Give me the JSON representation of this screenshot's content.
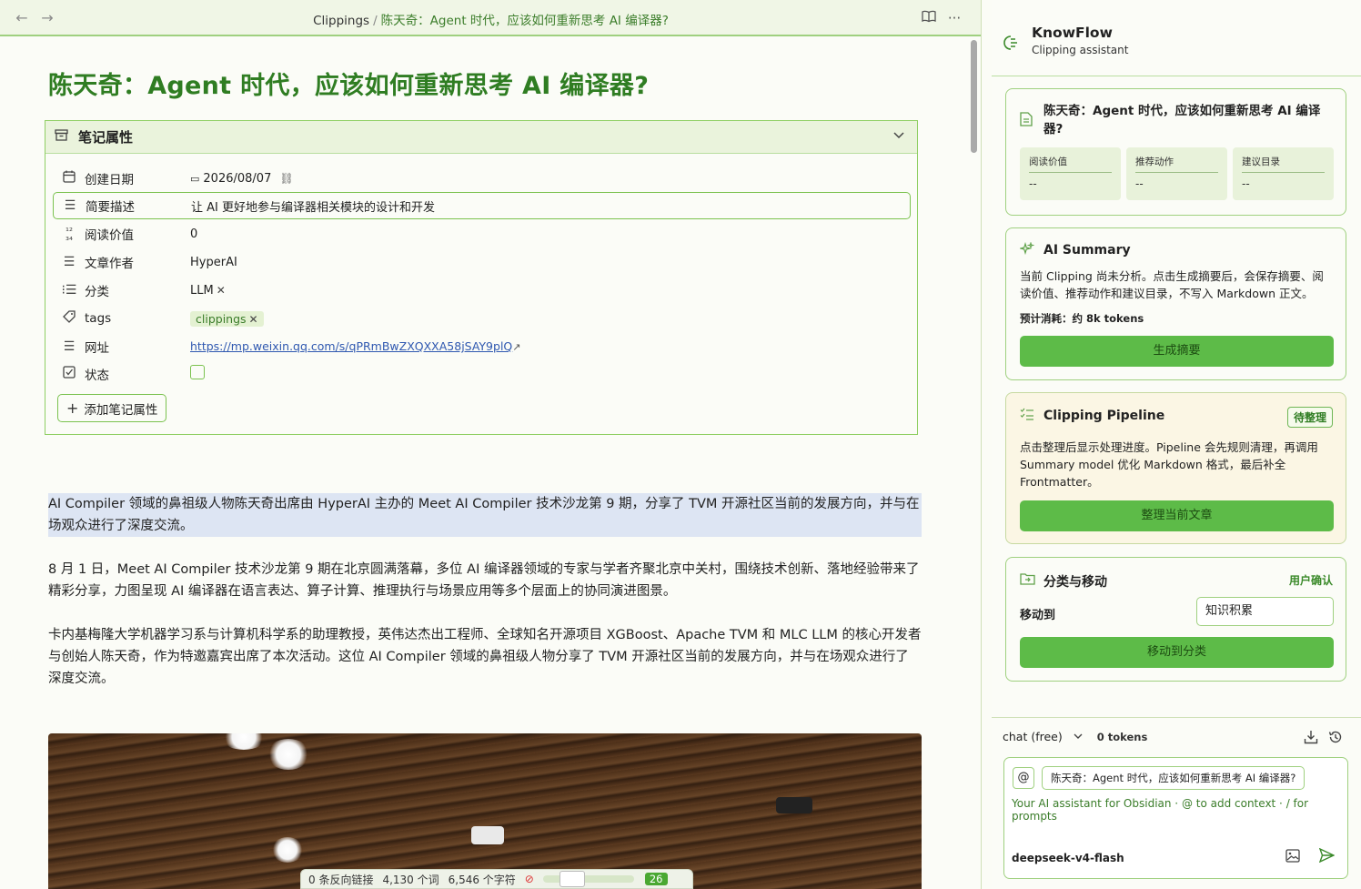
{
  "topbar": {
    "back": "←",
    "forward": "→",
    "crumb_root": "Clippings",
    "crumb_sep": "/",
    "crumb_current": "陈天奇：Agent 时代，应该如何重新思考 AI 编译器?",
    "book_icon": "📖",
    "more_icon": "···"
  },
  "doc": {
    "title": "陈天奇：Agent 时代，应该如何重新思考 AI 编译器?"
  },
  "properties": {
    "header": "笔记属性",
    "rows": [
      {
        "name": "创建日期",
        "icon": "calendar-icon",
        "value": "2026/08/07"
      },
      {
        "name": "简要描述",
        "icon": "text-icon",
        "value": "让 AI 更好地参与编译器相关模块的设计和开发"
      },
      {
        "name": "阅读价值",
        "icon": "number-icon",
        "value": "0"
      },
      {
        "name": "文章作者",
        "icon": "text-icon",
        "value": "HyperAI"
      },
      {
        "name": "分类",
        "icon": "list-icon",
        "value": "LLM"
      },
      {
        "name": "tags",
        "icon": "tag-icon",
        "value": "clippings"
      },
      {
        "name": "网址",
        "icon": "text-icon",
        "value": "https://mp.weixin.qq.com/s/qPRmBwZXQXXA58jSAY9plQ"
      },
      {
        "name": "状态",
        "icon": "checkbox-icon",
        "value": ""
      }
    ],
    "add_label": "添加笔记属性"
  },
  "body": {
    "p1": "AI Compiler 领域的鼻祖级人物陈天奇出席由 HyperAI 主办的 Meet AI Compiler 技术沙龙第 9 期，分享了 TVM 开源社区当前的发展方向，并与在场观众进行了深度交流。",
    "p2": "8 月 1 日，Meet AI Compiler 技术沙龙第 9 期在北京圆满落幕，多位 AI 编译器领域的专家与学者齐聚北京中关村，围绕技术创新、落地经验带来了精彩分享，力图呈现 AI 编译器在语言表达、算子计算、推理执行与场景应用等多个层面上的协同演进图景。",
    "p3": "卡内基梅隆大学机器学习系与计算机科学系的助理教授，英伟达杰出工程师、全球知名开源项目 XGBoost、Apache TVM 和 MLC LLM 的核心开发者与创始人陈天奇，作为特邀嘉宾出席了本次活动。这位 AI Compiler 领域的鼻祖级人物分享了 TVM 开源社区当前的发展方向，并与在场观众进行了深度交流。"
  },
  "statusbar": {
    "backlinks": "0 条反向链接",
    "words": "4,130 个词",
    "chars": "6,546 个字符",
    "slider_value": "26"
  },
  "sidebar": {
    "app_name": "KnowFlow",
    "app_sub": "Clipping assistant",
    "note_card": {
      "title": "陈天奇：Agent 时代，应该如何重新思考 AI 编译器?",
      "metrics": [
        {
          "label": "阅读价值",
          "value": "--"
        },
        {
          "label": "推荐动作",
          "value": "--"
        },
        {
          "label": "建议目录",
          "value": "--"
        }
      ]
    },
    "summary_card": {
      "title": "AI Summary",
      "text": "当前 Clipping 尚未分析。点击生成摘要后，会保存摘要、阅读价值、推荐动作和建议目录，不写入 Markdown 正文。",
      "cost": "预计消耗：约 8k tokens",
      "button": "生成摘要"
    },
    "pipeline_card": {
      "title": "Clipping Pipeline",
      "badge": "待整理",
      "text": "点击整理后显示处理进度。Pipeline 会先规则清理，再调用 Summary model 优化 Markdown 格式，最后补全 Frontmatter。",
      "button": "整理当前文章"
    },
    "move_card": {
      "title": "分类与移动",
      "confirm": "用户确认",
      "move_label": "移动到",
      "move_value": "知识积累",
      "button": "移动到分类"
    },
    "chat": {
      "model_select": "chat (free)",
      "tokens": "0 tokens",
      "at": "@",
      "context_pill": "陈天奇：Agent 时代，应该如何重新思考 AI 编译器?",
      "placeholder": "Your AI assistant for Obsidian · @ to add context · / for prompts",
      "model": "deepseek-v4-flash"
    }
  }
}
